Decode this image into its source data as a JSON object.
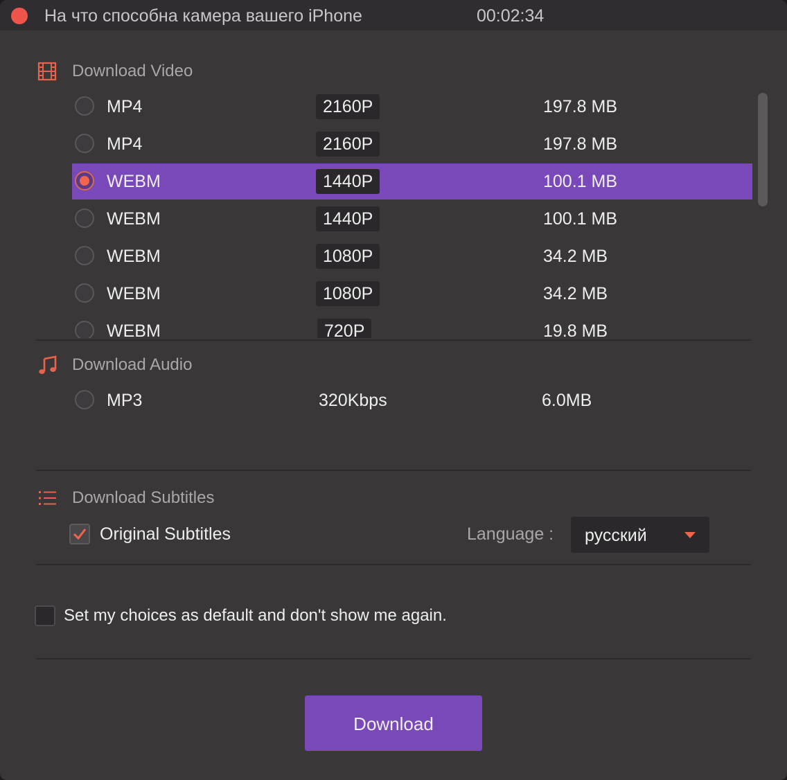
{
  "window": {
    "title": "На что способна камера вашего iPhone",
    "duration": "00:02:34"
  },
  "video_section": {
    "heading": "Download Video",
    "icon": "film-icon",
    "options": [
      {
        "format": "MP4",
        "resolution": "2160P",
        "size": "197.8 MB",
        "selected": false
      },
      {
        "format": "MP4",
        "resolution": "2160P",
        "size": "197.8 MB",
        "selected": false
      },
      {
        "format": "WEBM",
        "resolution": "1440P",
        "size": "100.1 MB",
        "selected": true
      },
      {
        "format": "WEBM",
        "resolution": "1440P",
        "size": "100.1 MB",
        "selected": false
      },
      {
        "format": "WEBM",
        "resolution": "1080P",
        "size": "34.2 MB",
        "selected": false
      },
      {
        "format": "WEBM",
        "resolution": "1080P",
        "size": "34.2 MB",
        "selected": false
      },
      {
        "format": "WEBM",
        "resolution": "720P",
        "size": "19.8 MB",
        "selected": false
      }
    ]
  },
  "audio_section": {
    "heading": "Download Audio",
    "icon": "music-note-icon",
    "options": [
      {
        "format": "MP3",
        "bitrate": "320Kbps",
        "size": "6.0MB",
        "selected": false
      }
    ]
  },
  "subtitles_section": {
    "heading": "Download Subtitles",
    "icon": "list-icon",
    "original_label": "Original Subtitles",
    "original_checked": true,
    "language_label": "Language :",
    "language_value": "русский"
  },
  "default_option": {
    "label": "Set my choices as default and don't show me again.",
    "checked": false
  },
  "download_button": "Download",
  "colors": {
    "accent": "#7a49b9",
    "highlight": "#f0654c",
    "background": "#3a3739"
  }
}
